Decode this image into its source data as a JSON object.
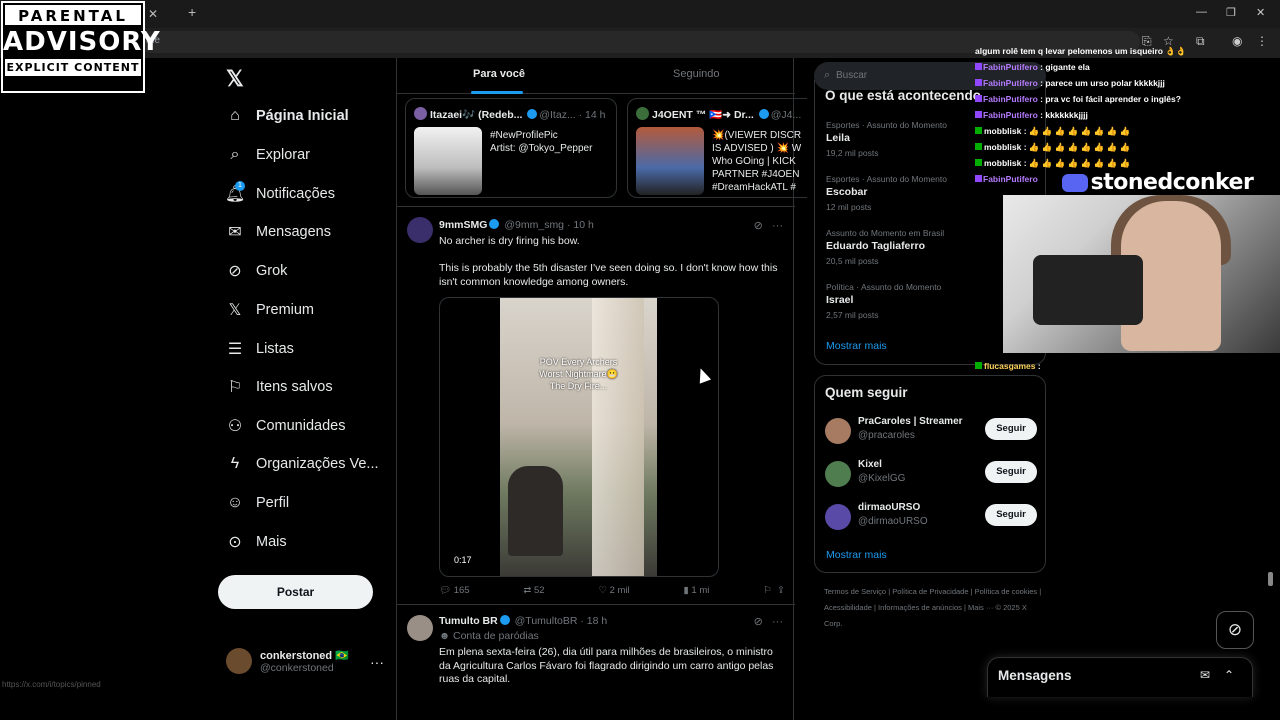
{
  "overlay": {
    "advisory_line1": "PARENTAL",
    "advisory_line2": "ADVISORY",
    "advisory_line3": "EXPLICIT CONTENT",
    "streamer_name": "stonedconker"
  },
  "browser": {
    "tab_label": "",
    "address_tail": "me",
    "status_url": "https://x.com/i/topics/pinned"
  },
  "nav": {
    "items": [
      {
        "label": "Página Inicial",
        "icon": "home-icon"
      },
      {
        "label": "Explorar",
        "icon": "search-icon"
      },
      {
        "label": "Notificações",
        "icon": "bell-icon"
      },
      {
        "label": "Mensagens",
        "icon": "envelope-icon"
      },
      {
        "label": "Grok",
        "icon": "grok-icon"
      },
      {
        "label": "Premium",
        "icon": "x-logo-icon"
      },
      {
        "label": "Listas",
        "icon": "list-icon"
      },
      {
        "label": "Itens salvos",
        "icon": "bookmark-icon"
      },
      {
        "label": "Comunidades",
        "icon": "people-icon"
      },
      {
        "label": "Organizações Ve...",
        "icon": "lightning-icon"
      },
      {
        "label": "Perfil",
        "icon": "person-icon"
      },
      {
        "label": "Mais",
        "icon": "more-circle-icon"
      }
    ],
    "notification_badge": "1",
    "post_label": "Postar",
    "account_name": "conkerstoned 🇧🇷",
    "account_handle": "@conkerstoned"
  },
  "feed": {
    "tab_for_you": "Para você",
    "tab_following": "Seguindo",
    "cards": [
      {
        "author": "Itazaei🎶 (Redeb...",
        "handle": "@Itaz...",
        "time": "· 14 h",
        "text": "#NewProfilePic\nArtist: @Tokyo_Pepper"
      },
      {
        "author": "J4OENT ™ 🇵🇷➜ Dr...",
        "handle": "@J4...",
        "time": "",
        "text": "💥(VIEWER DISCR\nIS ADVISED ) 💥 W\nWho GOing | KICK\nPARTNER #J4OEN\n#DreamHackATL #"
      }
    ],
    "tweet1": {
      "name": "9mmSMG",
      "handle": "@9mm_smg",
      "time": "· 10 h",
      "line1": "No archer is dry firing his bow.",
      "line2": "This is probably the 5th disaster I've seen doing so. I don't know how this isn't common knowledge among owners.",
      "video_caption": "POV Every Archers\nWorst Nightmare😬\nThe Dry Fire...",
      "duration": "0:17",
      "replies": "165",
      "reposts": "52",
      "likes": "2 mil",
      "views": "1 mi"
    },
    "tweet2": {
      "name": "Tumulto BR",
      "handle": "@TumultoBR",
      "time": "· 18 h",
      "sub": "Conta de paródias",
      "text": "Em plena sexta-feira (26), dia útil para milhões de brasileiros, o ministro da Agricultura Carlos Fávaro foi flagrado dirigindo um carro antigo pelas ruas da capital."
    }
  },
  "sidebar": {
    "search_placeholder": "Buscar",
    "trends_title": "O que está acontecendo",
    "trends": [
      {
        "category": "Esportes · Assunto do Momento",
        "name": "Leila",
        "count": "19,2 mil posts"
      },
      {
        "category": "Esportes · Assunto do Momento",
        "name": "Escobar",
        "count": "12 mil posts"
      },
      {
        "category": "Assunto do Momento em Brasil",
        "name": "Eduardo Tagliaferro",
        "count": "20,5 mil posts"
      },
      {
        "category": "Política · Assunto do Momento",
        "name": "Israel",
        "count": "2,57 mil posts"
      }
    ],
    "show_more": "Mostrar mais",
    "who_to_follow_title": "Quem seguir",
    "follow": [
      {
        "name": "PraCaroles | Streamer",
        "handle": "@pracaroles",
        "btn": "Seguir"
      },
      {
        "name": "Kixel",
        "handle": "@KixelGG",
        "btn": "Seguir"
      },
      {
        "name": "dirmaoURSO",
        "handle": "@dirmaoURSO",
        "btn": "Seguir"
      }
    ],
    "show_more_2": "Mostrar mais",
    "footer": "Termos de Serviço | Política de Privacidade | Política de cookies | Acessibilidade | Informações de anúncios | Mais ··· © 2025 X Corp."
  },
  "chat": [
    {
      "user": "",
      "text": "algum rolê tem q levar pelomenos um isqueiro 👌👌",
      "color": "#ffffff"
    },
    {
      "user": "FabinPutifero",
      "text": ": gigante ela",
      "color": "#b57bff"
    },
    {
      "user": "FabinPutifero",
      "text": ": parece um urso polar kkkkkjjj",
      "color": "#b57bff"
    },
    {
      "user": "FabinPutifero",
      "text": ": pra vc foi fácil aprender o inglês?",
      "color": "#b57bff"
    },
    {
      "user": "FabinPutifero",
      "text": ": kkkkkkkjjjj",
      "color": "#b57bff"
    },
    {
      "user": "mobblisk",
      "text": ": 👍 👍 👍 👍 👍 👍 👍 👍",
      "color": "#ffffff"
    },
    {
      "user": "mobblisk",
      "text": ": 👍 👍 👍 👍 👍 👍 👍 👍",
      "color": "#ffffff"
    },
    {
      "user": "mobblisk",
      "text": ": 👍 👍 👍 👍 👍 👍 👍 👍",
      "color": "#ffffff"
    },
    {
      "user": "FabinPutifero",
      "text": ": ...",
      "color": "#b57bff"
    },
    {
      "user": "flucasgames",
      "text": ":",
      "color": "#ffd35a"
    }
  ],
  "dock": {
    "messages_label": "Mensagens"
  },
  "colors": {
    "accent": "#1d9bf0",
    "background": "#000000",
    "border": "#2f3336",
    "muted": "#71767b"
  }
}
